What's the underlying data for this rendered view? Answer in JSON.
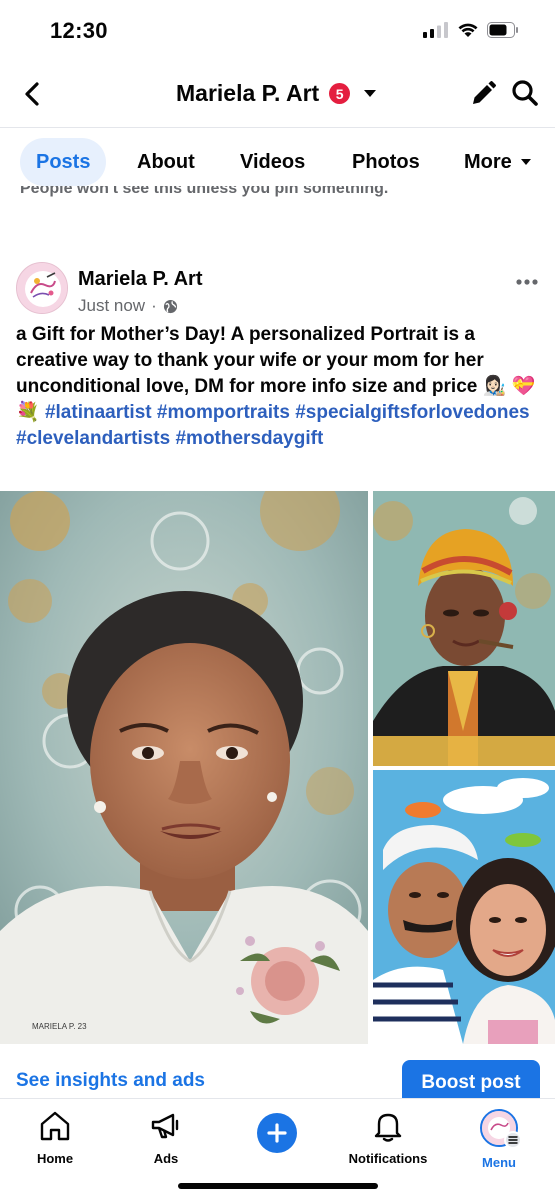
{
  "status_bar": {
    "time": "12:30"
  },
  "header": {
    "page_title": "Mariela P.  Art",
    "badge_count": "5"
  },
  "tabs": [
    {
      "label": "Posts"
    },
    {
      "label": "About"
    },
    {
      "label": "Videos"
    },
    {
      "label": "Photos"
    },
    {
      "label": "More"
    }
  ],
  "pin_note": "People won't see this unless you pin something.",
  "post": {
    "author": "Mariela P.  Art",
    "time": "Just now",
    "text": "a Gift for Mother’s Day! A personalized Portrait is a creative way to thank your wife or your mom for her unconditional love, DM for more info size and price 👩🏻‍🎨 💝💐",
    "hashtags": [
      "#latinaartist",
      "#momportraits",
      "#specialgiftsforlovedones",
      "#clevelandartists",
      "#mothersdaygift"
    ],
    "artist_signature": "MARIELA P. 23"
  },
  "actions": {
    "insights": "See insights and ads",
    "boost": "Boost post"
  },
  "bottom_nav": [
    {
      "label": "Home",
      "icon": "home-icon"
    },
    {
      "label": "Ads",
      "icon": "megaphone-icon"
    },
    {
      "label": "",
      "icon": "create-plus-icon"
    },
    {
      "label": "Notifications",
      "icon": "bell-icon"
    },
    {
      "label": "Menu",
      "icon": "menu-avatar-icon"
    }
  ],
  "colors": {
    "accent": "#1b74e4",
    "badge": "#e41e3f",
    "hashtag": "#2d5fbd",
    "secondary_text": "#65676b"
  }
}
